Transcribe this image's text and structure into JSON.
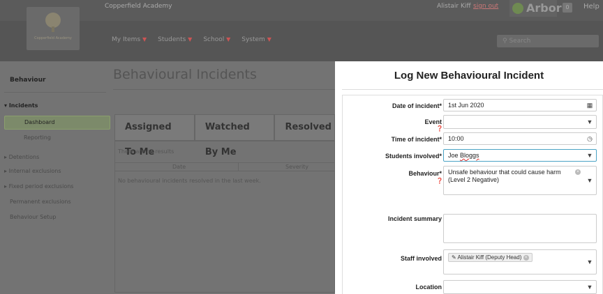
{
  "header": {
    "school_name": "Copperfield Academy",
    "logo_text": "Copperfield Academy",
    "user_name": "Alistair Kiff",
    "sign_out": "sign out",
    "brand": "Arbor",
    "notifications": "0",
    "help": "Help"
  },
  "nav": {
    "items": [
      {
        "label": "My Items"
      },
      {
        "label": "Students"
      },
      {
        "label": "School"
      },
      {
        "label": "System"
      }
    ],
    "search_placeholder": "Search"
  },
  "sidebar": {
    "title": "Behaviour",
    "items": [
      {
        "label": "Incidents"
      },
      {
        "label": "Dashboard"
      },
      {
        "label": "Reporting"
      },
      {
        "label": "Detentions"
      },
      {
        "label": "Internal exclusions"
      },
      {
        "label": "Fixed period exclusions"
      },
      {
        "label": "Permanent exclusions"
      },
      {
        "label": "Behaviour Setup"
      }
    ]
  },
  "main": {
    "title": "Behavioural Incidents",
    "tabs": [
      {
        "label": "Assigned To Me"
      },
      {
        "label": "Watched By Me"
      },
      {
        "label": "Resolved"
      }
    ],
    "no_results": "There are no results",
    "columns": [
      "Date",
      "Severity"
    ],
    "empty_message": "No behavioural incidents resolved in the last week."
  },
  "modal": {
    "title": "Log New Behavioural Incident",
    "fields": {
      "date": {
        "label": "Date of incident*",
        "value": "1st Jun 2020"
      },
      "event": {
        "label": "Event",
        "value": ""
      },
      "time": {
        "label": "Time of incident*",
        "value": "10:00"
      },
      "students": {
        "label": "Students involved*",
        "value_first": "Joe ",
        "value_spell": "Bloggs"
      },
      "behaviour": {
        "label": "Behaviour*",
        "value_line1": "Unsafe behaviour that could cause harm",
        "value_line2": "(Level 2 Negative)"
      },
      "summary": {
        "label": "Incident summary",
        "value": ""
      },
      "staff": {
        "label": "Staff involved",
        "chip": "Alistair Kiff (Deputy Head)"
      },
      "location": {
        "label": "Location",
        "value": ""
      }
    }
  }
}
